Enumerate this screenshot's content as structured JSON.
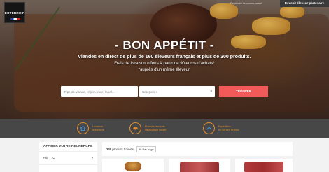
{
  "topbar": {
    "link_label": "Rejoindre la communauté",
    "pro_button": "Devenir éleveur partenaire"
  },
  "logo": {
    "text": "DOTERROIR"
  },
  "hero": {
    "title": "- BON APPÉTIT -",
    "line1": "Viandes en direct de plus de 160 éleveurs français et plus de 300 produits.",
    "line2": "Frais de livraison offerts à partir de 90 euros d'achats*",
    "line3": "*auprès d'un même éleveur."
  },
  "search": {
    "placeholder": "Type de viande, région, race, label...",
    "category_label": "Catégories",
    "button_label": "TROUVER"
  },
  "features": [
    {
      "icon": "home-icon",
      "line1": "Livraison",
      "line2": "à domicile"
    },
    {
      "icon": "leaf-icon",
      "line1": "Produits issus de",
      "line2": "l'agriculture locale"
    },
    {
      "icon": "truck-icon",
      "line1": "Expédition",
      "line2": "en 48h en France"
    }
  ],
  "filters": {
    "title": "AFFINER VOTRE RECHERCHE",
    "price_label": "Prix TTC"
  },
  "results": {
    "count": "330",
    "count_text": "produits trouvés",
    "per_page": "48 Par page"
  },
  "colors": {
    "accent": "#f25a5a",
    "features_bg": "#474747",
    "features_fg": "#e38c2c"
  }
}
